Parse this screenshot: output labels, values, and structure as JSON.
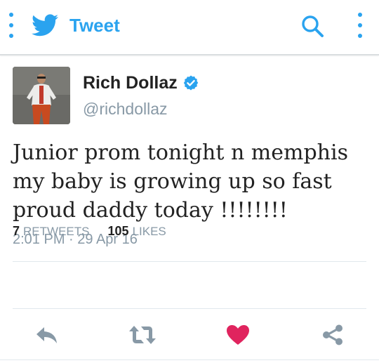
{
  "app_bar": {
    "title": "Tweet",
    "menu_icon": "vertical-dots-icon",
    "brand_icon": "twitter-bird-icon",
    "search_icon": "search-icon",
    "overflow_icon": "vertical-dots-icon",
    "accent_color": "#2aa3ef"
  },
  "tweet": {
    "display_name": "Rich Dollaz",
    "verified": true,
    "handle": "@richdollaz",
    "text": "Junior prom tonight n memphis\nmy baby is growing up so fast\nproud daddy today !!!!!!!!",
    "timestamp": "2:01 PM · 29 Apr 16",
    "retweets_count": "7",
    "retweets_label": "RETWEETS",
    "likes_count": "105",
    "likes_label": "LIKES"
  },
  "actions": [
    {
      "name": "reply",
      "icon": "reply-icon",
      "color": "#8899a6"
    },
    {
      "name": "retweet",
      "icon": "retweet-icon",
      "color": "#8899a6"
    },
    {
      "name": "like",
      "icon": "heart-icon",
      "color": "#e0245e",
      "active": true
    },
    {
      "name": "share",
      "icon": "share-icon",
      "color": "#8899a6"
    }
  ]
}
